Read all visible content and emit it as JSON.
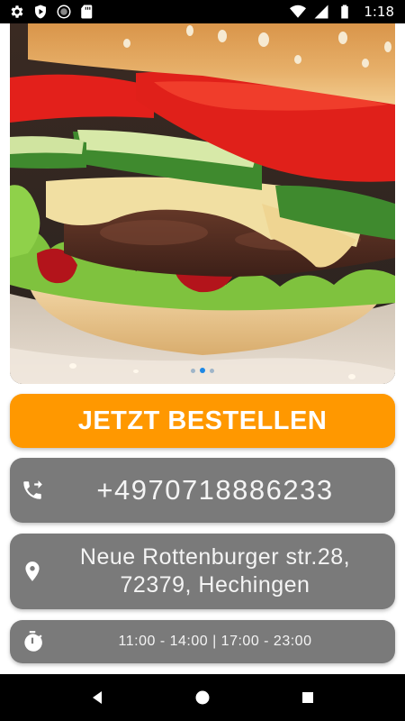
{
  "status_bar": {
    "time": "1:18",
    "left_icons": [
      "settings-icon",
      "shield-icon",
      "sync-icon",
      "sd-card-icon"
    ],
    "right_icons": [
      "wifi-icon",
      "cellular-icon",
      "battery-icon"
    ]
  },
  "hero": {
    "image": "burger-photo",
    "carousel_pages": 3,
    "active_page": 2
  },
  "order_button": {
    "label": "JETZT BESTELLEN",
    "color": "#ff9800"
  },
  "phone": {
    "icon": "phone-forward-icon",
    "number": "+4970718886233"
  },
  "address": {
    "icon": "location-pin-icon",
    "line1": "Neue Rottenburger str.28,",
    "line2": "72379, Hechingen"
  },
  "hours": {
    "icon": "stopwatch-icon",
    "text": "11:00 - 14:00 | 17:00 - 23:00"
  },
  "nav_bar": {
    "buttons": [
      "back-icon",
      "home-icon",
      "recents-icon"
    ]
  },
  "colors": {
    "accent": "#ff9800",
    "card": "#7a7a7a",
    "text_light": "#f4f4f4"
  }
}
